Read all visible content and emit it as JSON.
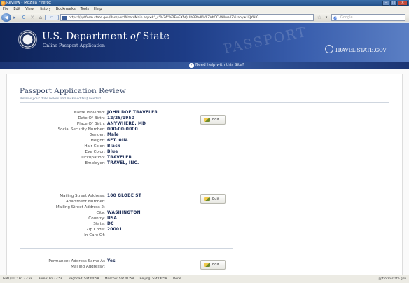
{
  "window": {
    "title": "Review - Mozilla Firefox"
  },
  "menu": [
    "File",
    "Edit",
    "View",
    "History",
    "Bookmarks",
    "Tools",
    "Help"
  ],
  "toolbar": {
    "url": "https://pptform.state.gov/PassportWizardMain.aspx#\"_s\"%2A\"%2FwEXAQUIb3RhdDVLZVbCCVNllwaIlZVuahyw1FJYNIG",
    "search_placeholder": "Google",
    "search_engine_icon": "google-icon"
  },
  "banner": {
    "dept_name_pre": "U.S. Department",
    "dept_name_of": "of",
    "dept_name_post": "State",
    "subtitle": "Online Passport Application",
    "watermark": "PASSPORT",
    "travel_logo": "TRAVEL.STATE.GOV"
  },
  "help": {
    "label": "Need help with this Site?"
  },
  "review": {
    "title": "Passport Application Review",
    "subtitle": "Review your data below and make edits if needed"
  },
  "personal": [
    {
      "label": "Name Provided:",
      "value": "JOHN DOE TRAVELER"
    },
    {
      "label": "Date Of Birth:",
      "value": "12/25/1950"
    },
    {
      "label": "Place Of Birth:",
      "value": "ANYWHERE, MD"
    },
    {
      "label": "Social Security Number:",
      "value": "000-00-0000"
    },
    {
      "label": "Gender:",
      "value": "Male"
    },
    {
      "label": "Height:",
      "value": "6FT. 0IN."
    },
    {
      "label": "Hair Color:",
      "value": "Black"
    },
    {
      "label": "Eye Color:",
      "value": "Blue"
    },
    {
      "label": "Occupation:",
      "value": "TRAVELER"
    },
    {
      "label": "Employer:",
      "value": "TRAVEL, INC."
    }
  ],
  "mailing": [
    {
      "label": "Mailing Street Address:",
      "value": "100 GLOBE ST"
    },
    {
      "label": "Apartment Number:",
      "value": ""
    },
    {
      "label": "Mailing Street Address 2:",
      "value": ""
    },
    {
      "label": "City:",
      "value": "WASHINGTON"
    },
    {
      "label": "Country:",
      "value": "USA"
    },
    {
      "label": "State:",
      "value": "DC"
    },
    {
      "label": "Zip Code:",
      "value": "20001"
    },
    {
      "label": "In Care Of:",
      "value": ""
    }
  ],
  "permanent": [
    {
      "label": "Permanent Address Same As",
      "value": "Yes"
    },
    {
      "label": "Mailing Address?:",
      "value": ""
    }
  ],
  "edit_label": "Edit",
  "statusbar": {
    "clocks": [
      "GMT/UTC: Fri 23:58",
      "Rome: Fri 23:58",
      "Baghdad: Sat 00:58",
      "Moscow: Sat 01:58",
      "Beijing: Sat 06:58",
      "Done"
    ],
    "domain": "pptform.state.gov"
  },
  "colors": {
    "banner_dark": "#0e2359",
    "banner_light": "#5b7fc4",
    "value_text": "#1e2e57"
  }
}
